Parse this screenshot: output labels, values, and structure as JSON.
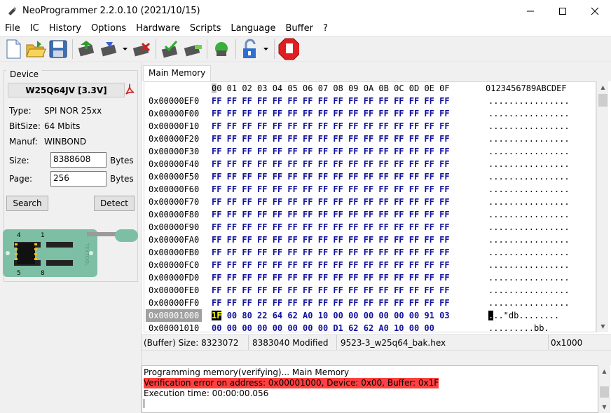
{
  "window": {
    "title": "NeoProgrammer 2.2.0.10 (2021/10/15)",
    "minimize": "—",
    "maximize": "☐",
    "close": "✕"
  },
  "menu": [
    "File",
    "IC",
    "History",
    "Options",
    "Hardware",
    "Scripts",
    "Language",
    "Buffer",
    "?"
  ],
  "toolbar": {
    "icons": [
      "new-file-icon",
      "open-folder-icon",
      "save-floppy-icon",
      "read-chip-icon",
      "write-chip-icon",
      "erase-chip-icon",
      "verify-chip-icon",
      "blank-check-icon",
      "auto-detect-icon",
      "lock-icon",
      "stop-icon"
    ]
  },
  "device": {
    "legend": "Device",
    "name": "W25Q64JV [3.3V]",
    "type_label": "Type:",
    "type_value": "SPI NOR  25xx",
    "bitsize_label": "BitSize:",
    "bitsize_value": "64 Mbits",
    "manuf_label": "Manuf:",
    "manuf_value": "WINBOND",
    "size_label": "Size:",
    "size_value": "8388608",
    "size_unit": "Bytes",
    "page_label": "Page:",
    "page_value": "256",
    "page_unit": "Bytes",
    "search_button": "Search",
    "detect_button": "Detect",
    "socket_pin_top": "4",
    "socket_pin_top2": "1",
    "socket_pin_bottom": "5",
    "socket_pin_bottom2": "8",
    "socket_brand": "TEXTOOL"
  },
  "tab": {
    "label": "Main Memory"
  },
  "hex": {
    "header_cols": "00 01 02 03 04 05 06 07 08 09 0A 0B 0C 0D 0E 0F",
    "header_ascii": "0123456789ABCDEF",
    "rows": [
      {
        "addr": "0x00000EF0",
        "bytes": "FF FF FF FF FF FF FF FF FF FF FF FF FF FF FF FF",
        "ascii": "................"
      },
      {
        "addr": "0x00000F00",
        "bytes": "FF FF FF FF FF FF FF FF FF FF FF FF FF FF FF FF",
        "ascii": "................"
      },
      {
        "addr": "0x00000F10",
        "bytes": "FF FF FF FF FF FF FF FF FF FF FF FF FF FF FF FF",
        "ascii": "................"
      },
      {
        "addr": "0x00000F20",
        "bytes": "FF FF FF FF FF FF FF FF FF FF FF FF FF FF FF FF",
        "ascii": "................"
      },
      {
        "addr": "0x00000F30",
        "bytes": "FF FF FF FF FF FF FF FF FF FF FF FF FF FF FF FF",
        "ascii": "................"
      },
      {
        "addr": "0x00000F40",
        "bytes": "FF FF FF FF FF FF FF FF FF FF FF FF FF FF FF FF",
        "ascii": "................"
      },
      {
        "addr": "0x00000F50",
        "bytes": "FF FF FF FF FF FF FF FF FF FF FF FF FF FF FF FF",
        "ascii": "................"
      },
      {
        "addr": "0x00000F60",
        "bytes": "FF FF FF FF FF FF FF FF FF FF FF FF FF FF FF FF",
        "ascii": "................"
      },
      {
        "addr": "0x00000F70",
        "bytes": "FF FF FF FF FF FF FF FF FF FF FF FF FF FF FF FF",
        "ascii": "................"
      },
      {
        "addr": "0x00000F80",
        "bytes": "FF FF FF FF FF FF FF FF FF FF FF FF FF FF FF FF",
        "ascii": "................"
      },
      {
        "addr": "0x00000F90",
        "bytes": "FF FF FF FF FF FF FF FF FF FF FF FF FF FF FF FF",
        "ascii": "................"
      },
      {
        "addr": "0x00000FA0",
        "bytes": "FF FF FF FF FF FF FF FF FF FF FF FF FF FF FF FF",
        "ascii": "................"
      },
      {
        "addr": "0x00000FB0",
        "bytes": "FF FF FF FF FF FF FF FF FF FF FF FF FF FF FF FF",
        "ascii": "................"
      },
      {
        "addr": "0x00000FC0",
        "bytes": "FF FF FF FF FF FF FF FF FF FF FF FF FF FF FF FF",
        "ascii": "................"
      },
      {
        "addr": "0x00000FD0",
        "bytes": "FF FF FF FF FF FF FF FF FF FF FF FF FF FF FF FF",
        "ascii": "................"
      },
      {
        "addr": "0x00000FE0",
        "bytes": "FF FF FF FF FF FF FF FF FF FF FF FF FF FF FF FF",
        "ascii": "................"
      },
      {
        "addr": "0x00000FF0",
        "bytes": "FF FF FF FF FF FF FF FF FF FF FF FF FF FF FF FF",
        "ascii": "................"
      },
      {
        "addr": "0x00001000",
        "first_byte": "1F",
        "bytes": "00 80 22 64 62 A0 10 00 00 00 00 00 00 91 03",
        "ascii_first": ".",
        "ascii": "..\"db........"
      },
      {
        "addr": "0x00001010",
        "bytes": "00 00 00 00 00 00 00 00 D1 62 62 A0 10 00 00",
        "ascii": ".........bb."
      }
    ]
  },
  "status": {
    "buffer_size": "(Buffer) Size: 8323072",
    "modified": "8383040 Modified",
    "filename": "9523-3_w25q64_bak.hex",
    "offset": "0x1000"
  },
  "log": {
    "line1": "Programming memory(verifying)... Main Memory",
    "line2": "Verification error on address: 0x00001000, Device: 0x00, Buffer: 0x1F",
    "line3": "Execution time: 00:00:00.056"
  },
  "colors": {
    "hex_bytes": "#10109e",
    "error_bg": "#ff4040",
    "selected_addr_bg": "#a0a0a0"
  }
}
